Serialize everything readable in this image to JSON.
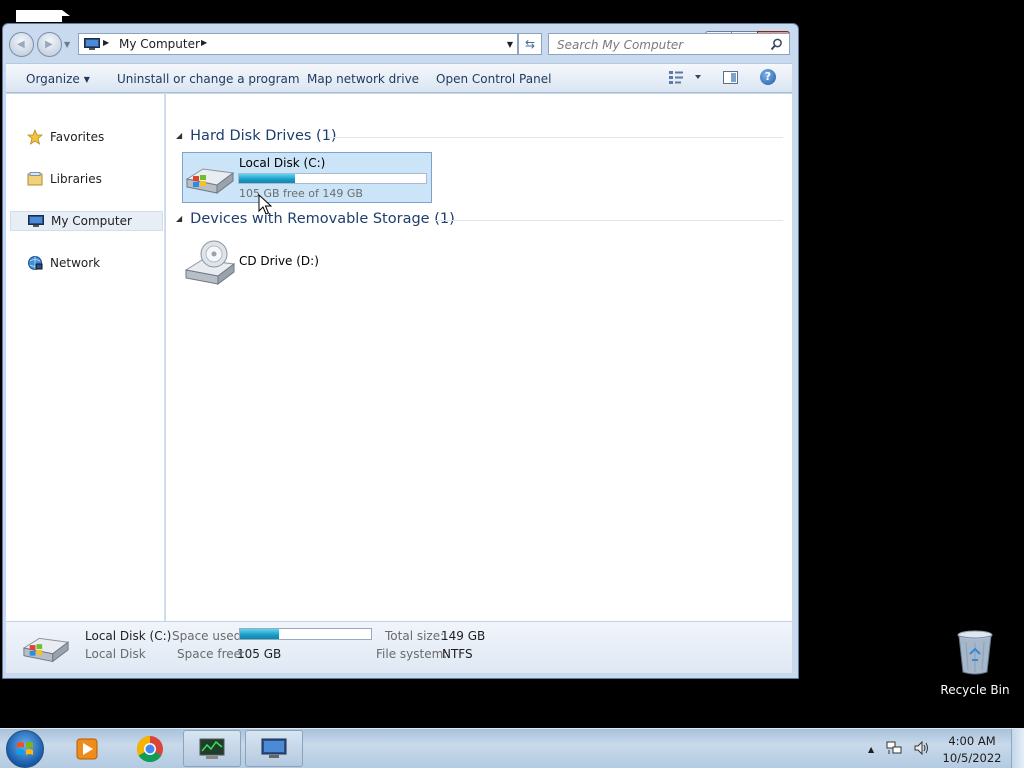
{
  "address": {
    "crumb": "My Computer",
    "search_placeholder": "Search My Computer"
  },
  "toolbar": {
    "organize": "Organize",
    "uninstall": "Uninstall or change a program",
    "map_drive": "Map network drive",
    "control_panel": "Open Control Panel"
  },
  "nav": {
    "items": [
      {
        "label": "Favorites"
      },
      {
        "label": "Libraries"
      },
      {
        "label": "My Computer",
        "selected": true
      },
      {
        "label": "Network"
      }
    ]
  },
  "content": {
    "groups": [
      {
        "title": "Hard Disk Drives (1)",
        "items": [
          {
            "name": "Local Disk (C:)",
            "free_text": "105 GB free of 149 GB",
            "used_fraction": 0.3
          }
        ]
      },
      {
        "title": "Devices with Removable Storage (1)",
        "items": [
          {
            "name": "CD Drive (D:)"
          }
        ]
      }
    ]
  },
  "details": {
    "name": "Local Disk (C:)",
    "type": "Local Disk",
    "space_used_label": "Space used:",
    "space_free_label": "Space free:",
    "space_free_value": "105 GB",
    "total_size_label": "Total size:",
    "total_size_value": "149 GB",
    "file_system_label": "File system:",
    "file_system_value": "NTFS",
    "used_fraction": 0.3
  },
  "desktop": {
    "recycle_bin": "Recycle Bin"
  },
  "taskbar": {
    "time": "4:00 AM",
    "date": "10/5/2022"
  },
  "colors": {
    "selection_bg": "#cce4f7",
    "bar_fill": "#1a9bc4",
    "group_header": "#1e3e6e"
  }
}
